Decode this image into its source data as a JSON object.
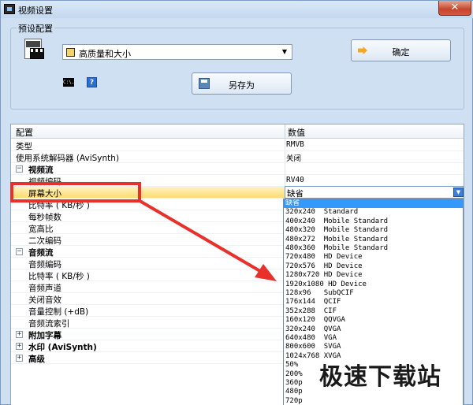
{
  "window": {
    "title": "视频设置",
    "close_label": "✕"
  },
  "preset": {
    "group_label": "预设配置",
    "selected": "高质量和大小",
    "ok_label": "确定",
    "save_as_label": "另存为",
    "cmd_label": "C:\\.",
    "help_label": "?"
  },
  "grid": {
    "col_config": "配置",
    "col_value": "数值",
    "rows": [
      {
        "name": "类型",
        "value": "RMVB"
      },
      {
        "name": "使用系统解码器 (AviSynth)",
        "value": "关闭"
      },
      {
        "name": "视频流",
        "value": "",
        "expander": "−"
      },
      {
        "name": "视频编码",
        "value": "RV40"
      },
      {
        "name": "屏幕大小",
        "value": "缺省"
      },
      {
        "name": "比特率 ( KB/秒 )",
        "value": ""
      },
      {
        "name": "每秒帧数",
        "value": ""
      },
      {
        "name": "宽高比",
        "value": ""
      },
      {
        "name": "二次编码",
        "value": ""
      },
      {
        "name": "音频流",
        "value": "",
        "expander": "−"
      },
      {
        "name": "音频编码",
        "value": ""
      },
      {
        "name": "比特率 ( KB/秒 )",
        "value": ""
      },
      {
        "name": "音频声道",
        "value": ""
      },
      {
        "name": "关闭音效",
        "value": ""
      },
      {
        "name": "音量控制 (+dB)",
        "value": ""
      },
      {
        "name": "音频流索引",
        "value": ""
      },
      {
        "name": "附加字幕",
        "value": "",
        "expander": "+"
      },
      {
        "name": "水印 (AviSynth)",
        "value": "",
        "expander": "+"
      },
      {
        "name": "高级",
        "value": "",
        "expander": "+"
      }
    ]
  },
  "dropdown": {
    "current": "缺省",
    "options": [
      "缺省",
      "320x240  Standard",
      "400x240  Mobile Standard",
      "480x320  Mobile Standard",
      "480x272  Mobile Standard",
      "480x360  Mobile Standard",
      "720x480  HD Device",
      "720x576  HD Device",
      "1280x720 HD Device",
      "1920x1080 HD Device",
      "128x96   SubQCIF",
      "176x144  QCIF",
      "352x288  CIF",
      "160x120  QQVGA",
      "320x240  QVGA",
      "640x480  VGA",
      "800x600  SVGA",
      "1024x768 XVGA",
      "50%",
      "200%",
      "360p",
      "480p",
      "720p"
    ]
  },
  "watermark": "极速下载站",
  "colors": {
    "highlight": "#e8312b",
    "selection": "#3399ff",
    "window_bg": "#cfe0f2"
  }
}
